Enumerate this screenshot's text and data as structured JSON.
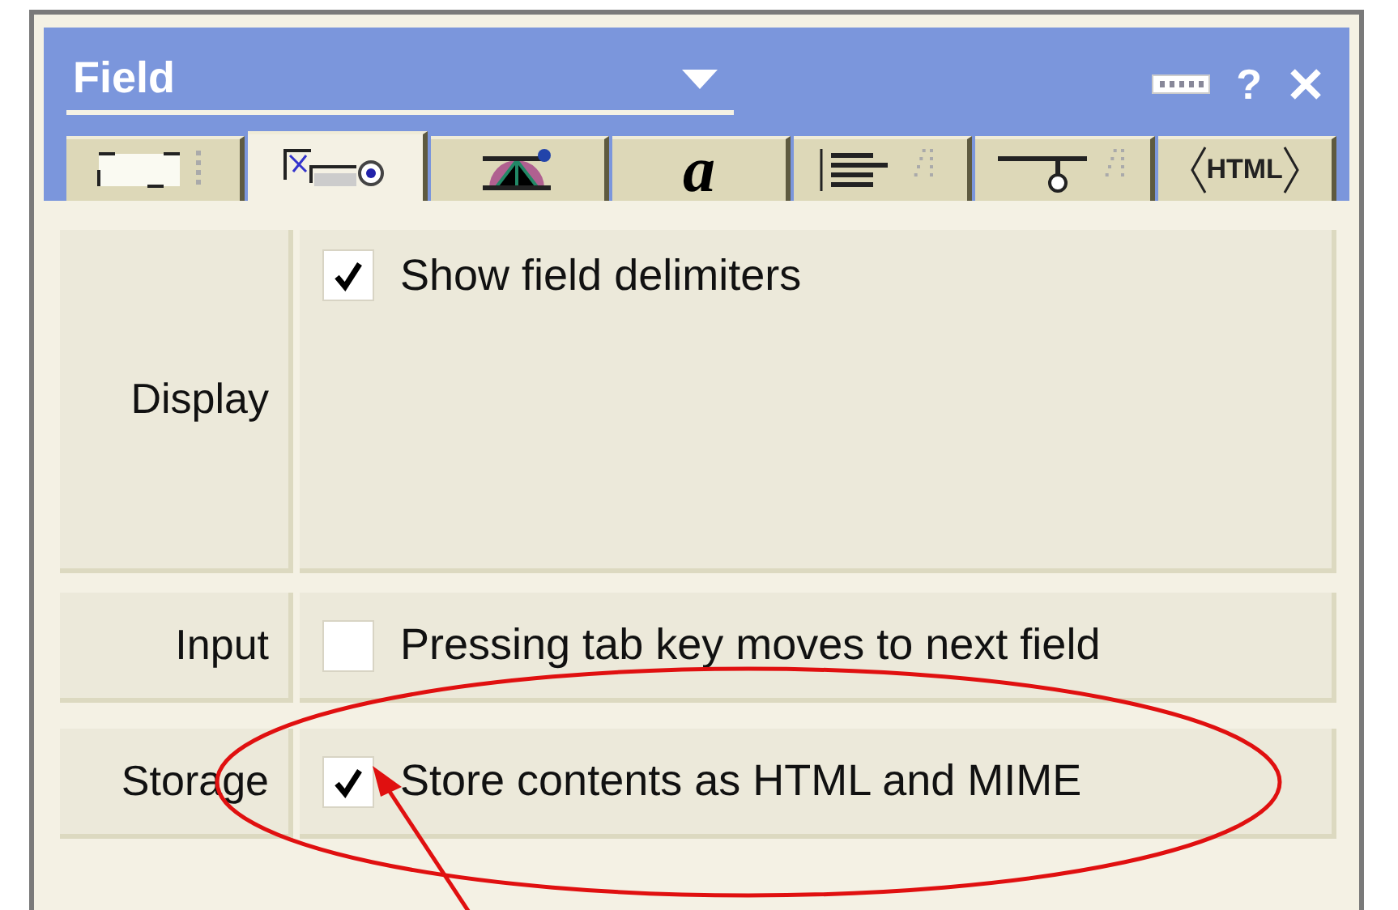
{
  "window": {
    "title": "Field",
    "help": "?"
  },
  "tabs": [
    {
      "kind": "box",
      "selected": false
    },
    {
      "kind": "field",
      "selected": true
    },
    {
      "kind": "palette",
      "selected": false
    },
    {
      "kind": "text",
      "label": "a",
      "selected": false
    },
    {
      "kind": "paragraph",
      "selected": false
    },
    {
      "kind": "hide",
      "selected": false
    },
    {
      "kind": "text",
      "label": "HTML",
      "selected": false
    }
  ],
  "sections": [
    {
      "label": "Display",
      "options": [
        {
          "text": "Show field delimiters",
          "checked": true
        }
      ]
    },
    {
      "label": "Input",
      "options": [
        {
          "text": "Pressing tab key moves to next field",
          "checked": false
        }
      ]
    },
    {
      "label": "Storage",
      "options": [
        {
          "text": "Store contents as HTML and MIME",
          "checked": true
        }
      ]
    }
  ],
  "annotation": {
    "highlight": true,
    "arrow": true
  }
}
